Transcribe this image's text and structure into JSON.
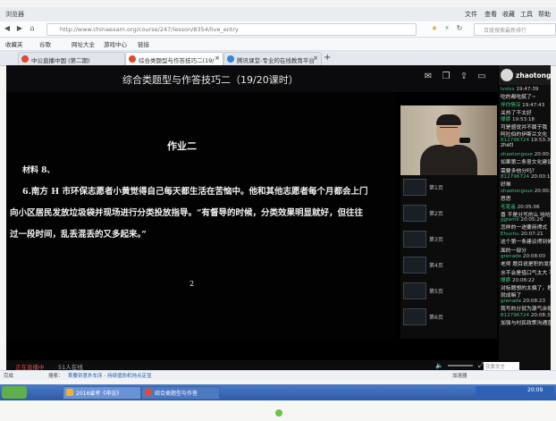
{
  "browser": {
    "app_name": "浏览器",
    "menu": [
      "文件",
      "查看",
      "收藏",
      "工具",
      "帮助"
    ],
    "url": "http://www.chinaexam.org/course/247/lesson/8354/live_entry",
    "search_placeholder": "百度搜索最新排行",
    "bookmarks": [
      "收藏夹",
      "谷歌",
      "网址大全",
      "游戏中心",
      "链接"
    ],
    "tabs": [
      {
        "label": "中公直播中国 (第二期)",
        "active": false
      },
      {
        "label": "综合类题型与作答技巧二(19/",
        "active": true
      },
      {
        "label": "腾讯课堂-专业的在线教育平台",
        "active": false
      }
    ],
    "new_tab": "+"
  },
  "player": {
    "lesson_title": "综合类题型与作答技巧二（19/20课时）",
    "live_status": "正在直播中",
    "online_count": "51人在线"
  },
  "slide": {
    "heading": "作业二",
    "material": "材料 8、",
    "para1": "6.南方 H 市环保志愿者小黄觉得自己每天都生活在苦恼中。他和其他志愿者每个月都会上门",
    "para2": "向小区居民发放垃圾袋并现场进行分类投放指导。“有督导的时候，分类效果明显就好，但往往",
    "para3": "过一段时间，乱丢混丢的又多起来。”",
    "page_number": "2"
  },
  "thumbnails": [
    "第1页",
    "第2页",
    "第3页",
    "第4页",
    "第5页",
    "第6页"
  ],
  "chat": {
    "current_user": "zhaotong",
    "input_placeholder": "我要发言",
    "messages": [
      {
        "user": "lvslvs",
        "time": "19:47:39",
        "text": "吃的都吃腻了~"
      },
      {
        "user": "伴你情深",
        "time": "19:47:43",
        "text": "关热了不太好"
      },
      {
        "user": "姗娜",
        "time": "19:53:18",
        "text": "可是感觉并不属于我"
      },
      {
        "user": "",
        "time": "",
        "text": "阿拉伯的伊斯兰文化"
      },
      {
        "user": "812796724",
        "time": "19:53:30",
        "text": "zhetl"
      },
      {
        "user": "shaotongsue",
        "time": "20:00:04",
        "text": "如果第二条意文化建设"
      },
      {
        "user": "",
        "time": "",
        "text": "需要多他分吗？"
      },
      {
        "user": "812796724",
        "time": "20:00:13",
        "text": "好难"
      },
      {
        "user": "shaotongsue",
        "time": "20:00:22",
        "text": "思思"
      },
      {
        "user": "毛笔遥",
        "time": "20:05:06",
        "text": "喜 不是分写的么 哈哈"
      },
      {
        "user": "gglamil",
        "time": "20:05:26",
        "text": "怎样的一迹要用得式"
      },
      {
        "user": "Ehuchu",
        "time": "20:07:21",
        "text": "这个第一条建议得到佛"
      },
      {
        "user": "",
        "time": "",
        "text": "面的一部分"
      },
      {
        "user": "grenade",
        "time": "20:08:00",
        "text": "老师 题目说是积的发展"
      },
      {
        "user": "",
        "time": "",
        "text": "水不会是借口气太大 不在"
      },
      {
        "user": "姗娜",
        "time": "20:08:22",
        "text": "对标题想的太偏了，把握"
      },
      {
        "user": "",
        "time": "",
        "text": "就成嘛了"
      },
      {
        "user": "grenade",
        "time": "20:08:23",
        "text": "我写的分就为源气余很分"
      },
      {
        "user": "812796724",
        "time": "20:08:33",
        "text": "加强与村民政策沟通宣传？"
      }
    ]
  },
  "statusbar": {
    "text1": "完成",
    "text2": "搜索：",
    "link": "首要到意外车床 - 持续值防机地点定显",
    "right": "加速器"
  },
  "taskbar": {
    "buttons": [
      "2016省考《申论》",
      "综合类题型与作答"
    ],
    "clock": "20:09"
  }
}
